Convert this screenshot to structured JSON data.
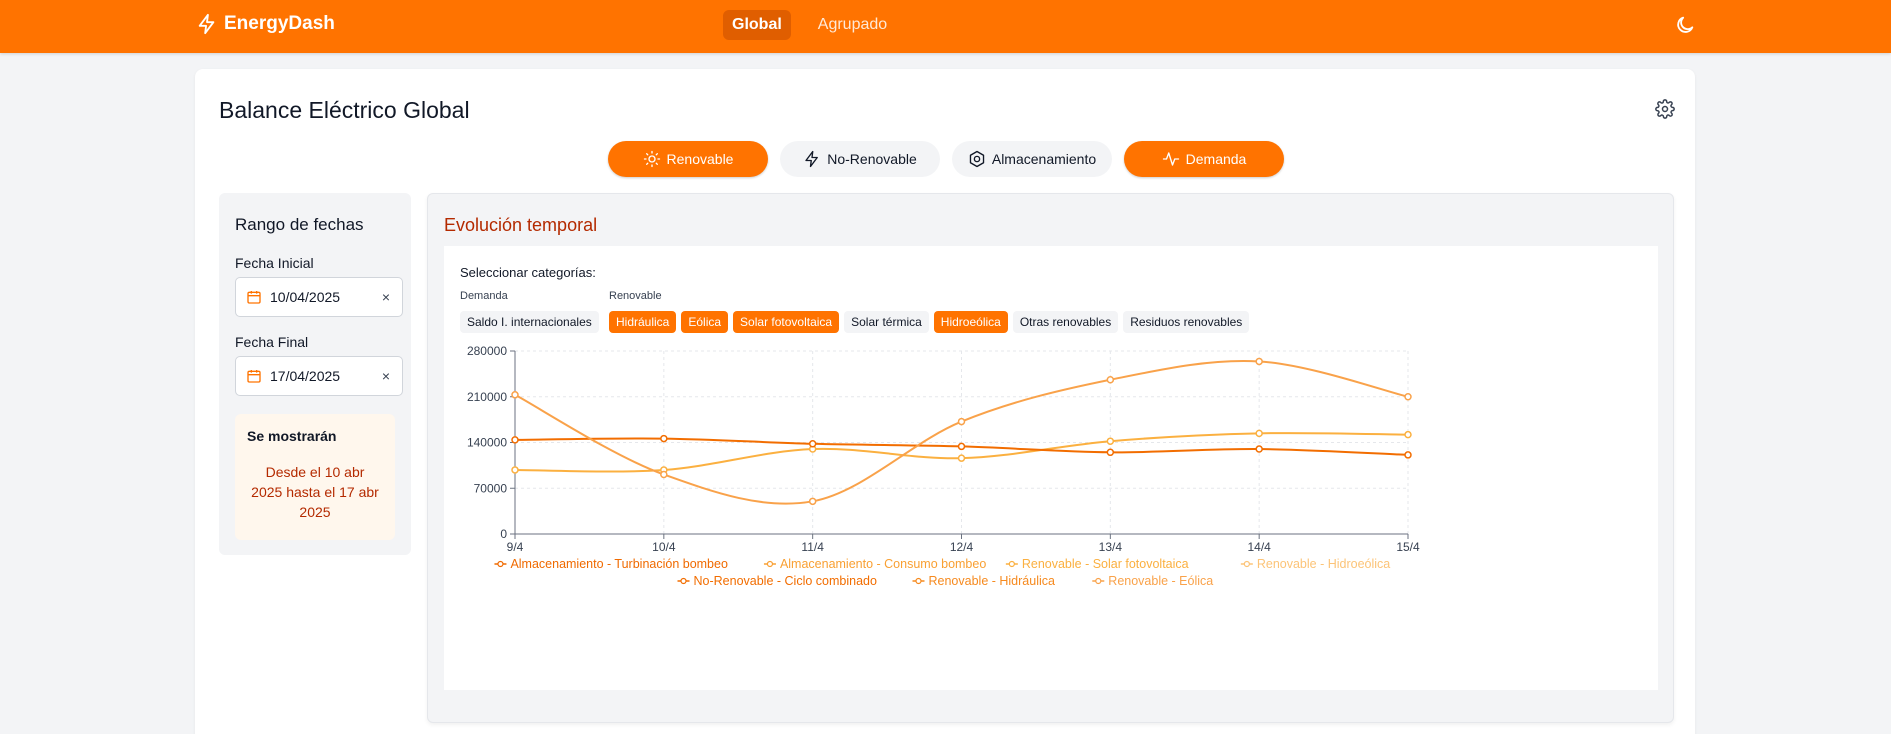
{
  "header": {
    "brand": "EnergyDash",
    "nav": [
      {
        "label": "Global",
        "active": true
      },
      {
        "label": "Agrupado",
        "active": false
      }
    ]
  },
  "main": {
    "title": "Balance Eléctrico Global",
    "categories": [
      {
        "label": "Renovable",
        "active": true,
        "icon": "sun-icon"
      },
      {
        "label": "No-Renovable",
        "active": false,
        "icon": "bolt-icon"
      },
      {
        "label": "Almacenamiento",
        "active": false,
        "icon": "hexagon-icon"
      },
      {
        "label": "Demanda",
        "active": true,
        "icon": "pulse-icon"
      }
    ]
  },
  "sidebar": {
    "title": "Rango de fechas",
    "start_label": "Fecha Inicial",
    "start_value": "10/04/2025",
    "end_label": "Fecha Final",
    "end_value": "17/04/2025",
    "clear_glyph": "×",
    "note_title": "Se mostrarán",
    "note_text": "Desde el 10 abr 2025 hasta el 17 abr 2025"
  },
  "panel": {
    "title": "Evolución temporal",
    "select_label": "Seleccionar categorías:",
    "groups": [
      {
        "label": "Demanda",
        "chips": [
          {
            "label": "Saldo I. internacionales",
            "active": false
          }
        ]
      },
      {
        "label": "Renovable",
        "chips": [
          {
            "label": "Hidráulica",
            "active": true
          },
          {
            "label": "Eólica",
            "active": true
          },
          {
            "label": "Solar fotovoltaica",
            "active": true
          },
          {
            "label": "Solar térmica",
            "active": false
          },
          {
            "label": "Hidroeólica",
            "active": true
          },
          {
            "label": "Otras renovables",
            "active": false
          },
          {
            "label": "Residuos renovables",
            "active": false
          }
        ]
      }
    ]
  },
  "chart_data": {
    "type": "line",
    "x": [
      "9/4",
      "10/4",
      "11/4",
      "12/4",
      "13/4",
      "14/4",
      "15/4"
    ],
    "y_ticks": [
      0,
      70000,
      140000,
      210000,
      280000
    ],
    "ylim": [
      0,
      280000
    ],
    "grid": true,
    "legend_position": "bottom",
    "series": [
      {
        "name": "Almacenamiento - Turbinación bombeo",
        "color": "#f06a00",
        "values": [
          null,
          null,
          null,
          null,
          null,
          null,
          null
        ]
      },
      {
        "name": "Almacenamiento - Consumo bombeo",
        "color": "#f9a033",
        "values": [
          null,
          null,
          null,
          null,
          null,
          null,
          null
        ]
      },
      {
        "name": "Renovable - Solar fotovoltaica",
        "color": "#fbb040",
        "values": [
          98000,
          98000,
          130000,
          116000,
          142000,
          154000,
          152000
        ]
      },
      {
        "name": "Renovable - Hidroeólica",
        "color": "#fcc478",
        "values": [
          null,
          null,
          null,
          null,
          null,
          null,
          null
        ]
      },
      {
        "name": "No-Renovable - Ciclo combinado",
        "color": "#f26d00",
        "values": [
          144000,
          146000,
          138000,
          134000,
          125000,
          130000,
          121000
        ]
      },
      {
        "name": "Renovable - Hidráulica",
        "color": "#f68a1f",
        "values": [
          null,
          null,
          null,
          null,
          null,
          null,
          null
        ]
      },
      {
        "name": "Renovable - Eólica",
        "color": "#f9a24a",
        "values": [
          213000,
          91000,
          50000,
          172000,
          236000,
          264000,
          210000
        ]
      }
    ]
  }
}
